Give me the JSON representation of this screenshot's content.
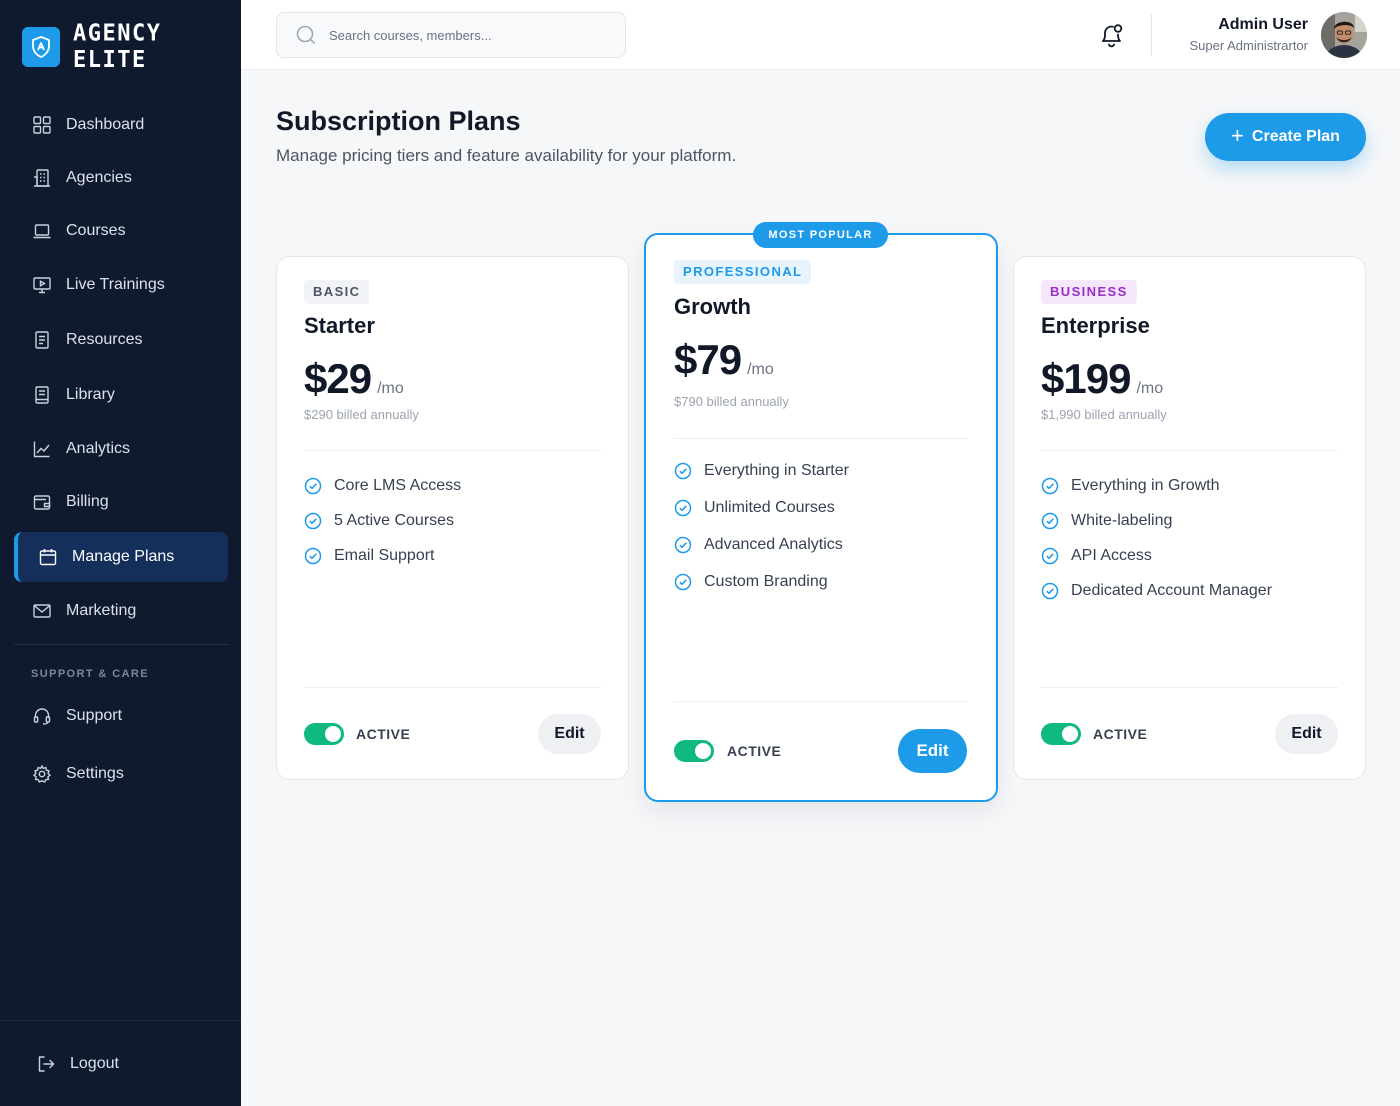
{
  "brand": {
    "name": "AGENCY ELITE"
  },
  "sidebar": {
    "items": [
      {
        "label": "Dashboard",
        "icon": "grid-icon"
      },
      {
        "label": "Agencies",
        "icon": "building-icon"
      },
      {
        "label": "Courses",
        "icon": "laptop-icon"
      },
      {
        "label": "Live Trainings",
        "icon": "monitor-play-icon"
      },
      {
        "label": "Resources",
        "icon": "document-icon"
      },
      {
        "label": "Library",
        "icon": "book-icon"
      },
      {
        "label": "Analytics",
        "icon": "chart-line-icon"
      },
      {
        "label": "Billing",
        "icon": "wallet-icon"
      },
      {
        "label": "Manage Plans",
        "icon": "calendar-icon",
        "active": true
      },
      {
        "label": "Marketing",
        "icon": "mail-icon"
      }
    ],
    "section_label": "SUPPORT & CARE",
    "support_items": [
      {
        "label": "Support",
        "icon": "headset-icon"
      },
      {
        "label": "Settings",
        "icon": "gear-icon"
      }
    ],
    "logout_label": "Logout"
  },
  "topbar": {
    "search_placeholder": "Search courses, members...",
    "user_name": "Admin User",
    "user_role": "Super Administrartor"
  },
  "page": {
    "title": "Subscription Plans",
    "subtitle": "Manage pricing tiers and feature availability for your platform.",
    "create_label": "Create Plan"
  },
  "plans": [
    {
      "tier": "BASIC",
      "name": "Starter",
      "price": "$29",
      "period": "/mo",
      "annual": "$290 billed annually",
      "features": [
        "Core LMS Access",
        "5 Active Courses",
        "Email Support"
      ],
      "status": "ACTIVE",
      "edit_label": "Edit"
    },
    {
      "badge": "MOST POPULAR",
      "tier": "PROFESSIONAL",
      "name": "Growth",
      "price": "$79",
      "period": "/mo",
      "annual": "$790 billed annually",
      "features": [
        "Everything in Starter",
        "Unlimited Courses",
        "Advanced Analytics",
        "Custom Branding"
      ],
      "status": "ACTIVE",
      "edit_label": "Edit"
    },
    {
      "tier": "BUSINESS",
      "name": "Enterprise",
      "price": "$199",
      "period": "/mo",
      "annual": "$1,990 billed annually",
      "features": [
        "Everything in Growth",
        "White-labeling",
        "API Access",
        "Dedicated Account Manager"
      ],
      "status": "ACTIVE",
      "edit_label": "Edit"
    }
  ],
  "colors": {
    "sidebar_bg": "#101a2e",
    "accent": "#1d9be8",
    "active_toggle": "#10b981",
    "business_tier": "#9b2dc8"
  }
}
